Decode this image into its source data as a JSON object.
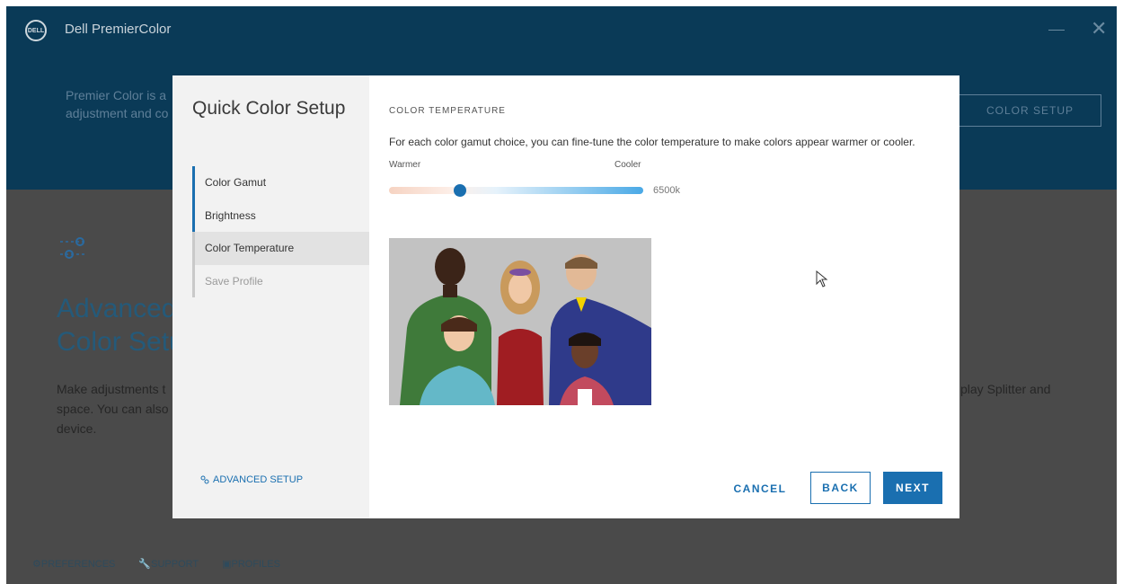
{
  "app": {
    "logo_text": "DELL",
    "title": "Dell PremierColor",
    "header_description": "Premier Color is a … adjustment and co…",
    "header_desc_line1": "Premier Color is a",
    "header_desc_line2": "adjustment and co",
    "header_button": "COLOR SETUP",
    "advanced_title_line1": "Advanced",
    "advanced_title_line2": "Color Setu",
    "advanced_desc_line1": "Make adjustments t",
    "advanced_desc_line2": "space. You can also",
    "advanced_desc_line3": "device.",
    "advanced_desc_right": "play Splitter and",
    "footer": {
      "preferences": "PREFERENCES",
      "support": "SUPPORT",
      "profiles": "PROFILES"
    }
  },
  "modal": {
    "title": "Quick Color Setup",
    "steps": [
      {
        "label": "Color Gamut",
        "state": "done"
      },
      {
        "label": "Brightness",
        "state": "done"
      },
      {
        "label": "Color Temperature",
        "state": "active"
      },
      {
        "label": "Save Profile",
        "state": "pending"
      }
    ],
    "advanced_setup_link": "ADVANCED SETUP",
    "section_label": "COLOR TEMPERATURE",
    "section_description": "For each color gamut choice, you can fine-tune the color temperature to make colors appear warmer or cooler.",
    "slider": {
      "min_label": "Warmer",
      "max_label": "Cooler",
      "value_label": "6500k",
      "position_fraction": 0.28
    },
    "buttons": {
      "cancel": "CANCEL",
      "back": "BACK",
      "next": "NEXT"
    }
  },
  "colors": {
    "header_bg": "#0a3a57",
    "accent": "#1a6fb0",
    "overlay": "#4a4a4a"
  }
}
